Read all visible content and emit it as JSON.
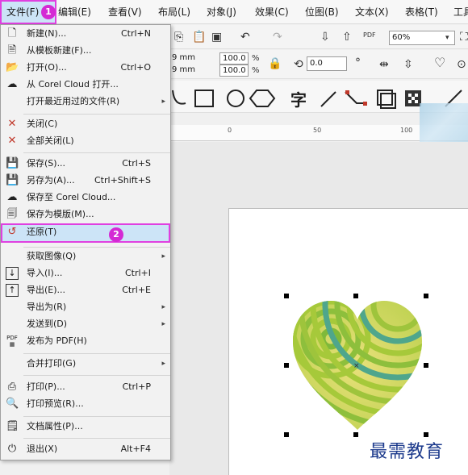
{
  "menubar": {
    "items": [
      "文件(F)",
      "编辑(E)",
      "查看(V)",
      "布局(L)",
      "对象(J)",
      "效果(C)",
      "位图(B)",
      "文本(X)",
      "表格(T)",
      "工具"
    ],
    "step1_badge": "1"
  },
  "toolbar": {
    "zoom_value": "60%",
    "width_field": "9 mm",
    "height_field": "9 mm",
    "scale_x": "100.0",
    "scale_y": "100.0",
    "percent_x": "%",
    "percent_y": "%",
    "rotation_value": "0.0",
    "rotation_unit": "°",
    "text_tool_glyph": "字"
  },
  "ruler": {
    "labels": [
      "0",
      "50",
      "100"
    ]
  },
  "file_menu": {
    "items": [
      {
        "icon": "new-doc-icon",
        "glyph": "🗋",
        "label": "新建(N)...",
        "shortcut": "Ctrl+N"
      },
      {
        "icon": "template-new-icon",
        "glyph": "🗎",
        "label": "从模板新建(F)...",
        "shortcut": ""
      },
      {
        "icon": "folder-open-icon",
        "glyph": "📂",
        "label": "打开(O)...",
        "shortcut": "Ctrl+O"
      },
      {
        "icon": "cloud-open-icon",
        "glyph": "☁",
        "label": "从 Corel Cloud 打开...",
        "shortcut": ""
      },
      {
        "icon": "",
        "glyph": "",
        "label": "打开最近用过的文件(R)",
        "shortcut": "",
        "submenu": true
      },
      {
        "icon": "close-doc-icon",
        "glyph": "✕",
        "label": "关闭(C)",
        "shortcut": ""
      },
      {
        "icon": "close-all-icon",
        "glyph": "✕",
        "label": "全部关闭(L)",
        "shortcut": ""
      },
      {
        "icon": "save-icon",
        "glyph": "💾",
        "label": "保存(S)...",
        "shortcut": "Ctrl+S"
      },
      {
        "icon": "save-as-icon",
        "glyph": "💾",
        "label": "另存为(A)...",
        "shortcut": "Ctrl+Shift+S"
      },
      {
        "icon": "cloud-save-icon",
        "glyph": "☁",
        "label": "保存至 Corel Cloud...",
        "shortcut": ""
      },
      {
        "icon": "save-template-icon",
        "glyph": "🗐",
        "label": "保存为模版(M)...",
        "shortcut": ""
      },
      {
        "icon": "revert-icon",
        "glyph": "↺",
        "label": "还原(T)",
        "shortcut": "",
        "highlight": true
      },
      {
        "icon": "",
        "glyph": "",
        "label": "获取图像(Q)",
        "shortcut": "",
        "submenu": true
      },
      {
        "icon": "import-icon",
        "glyph": "↓",
        "label": "导入(I)...",
        "shortcut": "Ctrl+I"
      },
      {
        "icon": "export-icon",
        "glyph": "↑",
        "label": "导出(E)...",
        "shortcut": "Ctrl+E"
      },
      {
        "icon": "",
        "glyph": "",
        "label": "导出为(R)",
        "shortcut": "",
        "submenu": true
      },
      {
        "icon": "",
        "glyph": "",
        "label": "发送到(D)",
        "shortcut": "",
        "submenu": true
      },
      {
        "icon": "pdf-icon",
        "glyph": "PDF",
        "label": "发布为 PDF(H)",
        "shortcut": ""
      },
      {
        "icon": "",
        "glyph": "",
        "label": "合并打印(G)",
        "shortcut": "",
        "submenu": true
      },
      {
        "icon": "print-icon",
        "glyph": "⎙",
        "label": "打印(P)...",
        "shortcut": "Ctrl+P"
      },
      {
        "icon": "print-preview-icon",
        "glyph": "🔍",
        "label": "打印预览(R)...",
        "shortcut": ""
      },
      {
        "icon": "doc-properties-icon",
        "glyph": "🗒",
        "label": "文档属性(P)...",
        "shortcut": ""
      },
      {
        "icon": "exit-icon",
        "glyph": "⏻",
        "label": "退出(X)",
        "shortcut": "Alt+F4"
      }
    ],
    "step2_badge": "2",
    "submenu_arrow": "▸"
  },
  "watermark": "最需教育",
  "colors": {
    "highlight_border": "#e040e0",
    "highlight_fill": "#cce4f7",
    "badge": "#d42ad4",
    "heart_green": "#a6c93a",
    "heart_yellow": "#e8e07a",
    "heart_teal": "#4fa68c"
  }
}
